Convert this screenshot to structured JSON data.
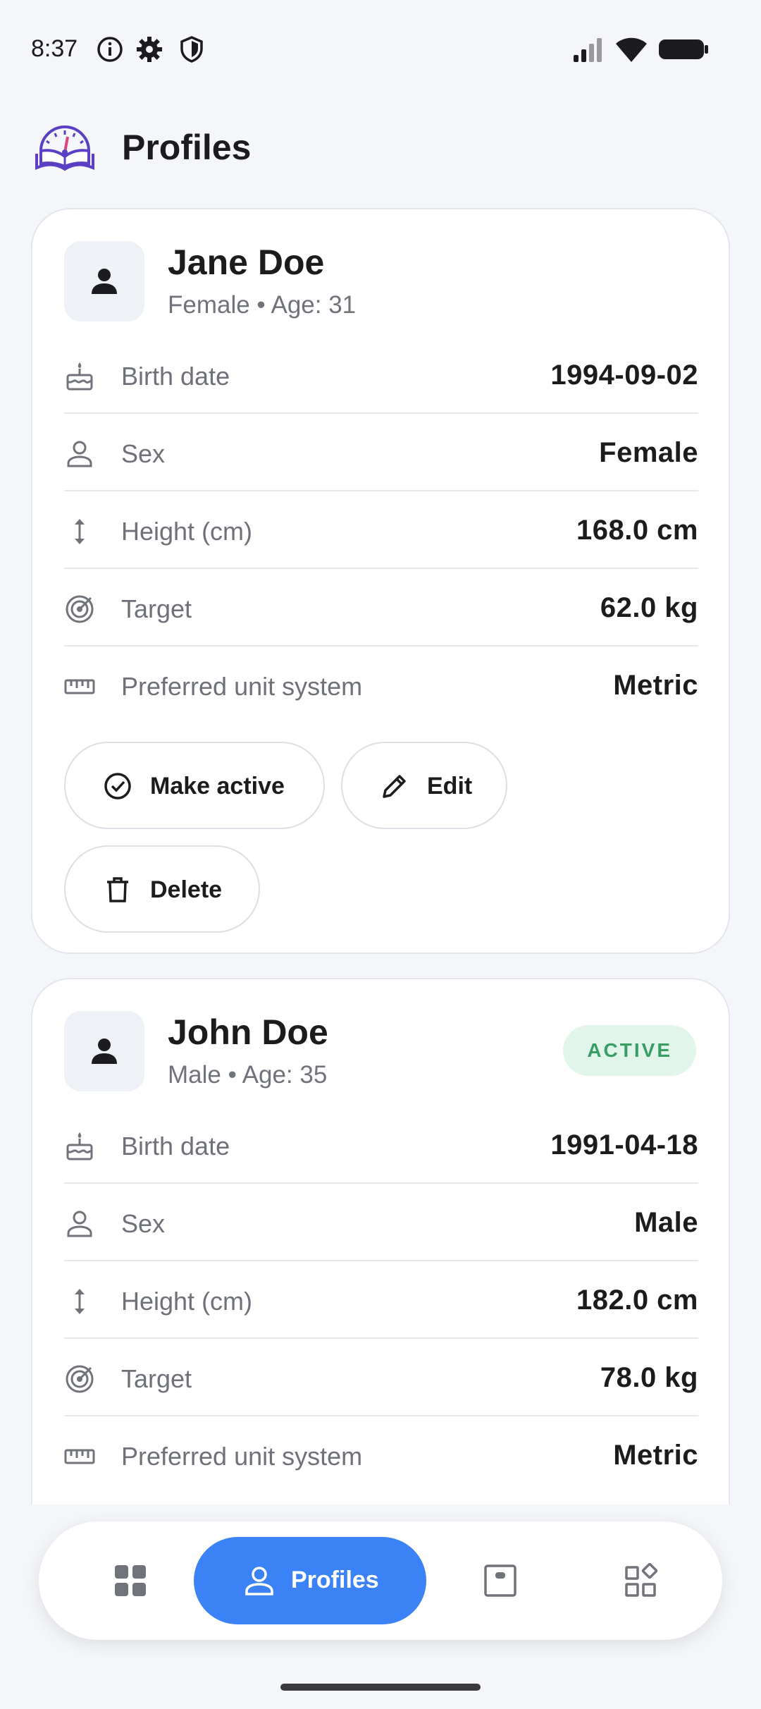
{
  "status_bar": {
    "time": "8:37",
    "left_icons": [
      "info-icon",
      "gear-icon",
      "shield-icon"
    ],
    "right_icons": [
      "signal-icon",
      "wifi-icon",
      "battery-icon"
    ]
  },
  "header": {
    "title": "Profiles",
    "logo_icon": "book-gauge-logo"
  },
  "profiles": [
    {
      "name": "Jane Doe",
      "subtitle": "Female • Age: 31",
      "active": false,
      "rows": [
        {
          "icon": "cake-icon",
          "label": "Birth date",
          "value": "1994-09-02"
        },
        {
          "icon": "person-icon",
          "label": "Sex",
          "value": "Female"
        },
        {
          "icon": "height-arrows-icon",
          "label": "Height (cm)",
          "value": "168.0 cm"
        },
        {
          "icon": "target-icon",
          "label": "Target",
          "value": "62.0 kg"
        },
        {
          "icon": "ruler-icon",
          "label": "Preferred unit system",
          "value": "Metric"
        }
      ],
      "actions": {
        "make_active": "Make active",
        "edit": "Edit",
        "delete": "Delete"
      }
    },
    {
      "name": "John Doe",
      "subtitle": "Male • Age: 35",
      "active": true,
      "badge": "ACTIVE",
      "rows": [
        {
          "icon": "cake-icon",
          "label": "Birth date",
          "value": "1991-04-18"
        },
        {
          "icon": "person-icon",
          "label": "Sex",
          "value": "Male"
        },
        {
          "icon": "height-arrows-icon",
          "label": "Height (cm)",
          "value": "182.0 cm"
        },
        {
          "icon": "target-icon",
          "label": "Target",
          "value": "78.0 kg"
        },
        {
          "icon": "ruler-icon",
          "label": "Preferred unit system",
          "value": "Metric"
        }
      ]
    }
  ],
  "bottom_nav": {
    "items": [
      {
        "icon": "dashboard-icon",
        "label": ""
      },
      {
        "icon": "person-icon",
        "label": "Profiles",
        "selected": true
      },
      {
        "icon": "scale-icon",
        "label": ""
      },
      {
        "icon": "more-apps-icon",
        "label": ""
      }
    ]
  },
  "colors": {
    "accent": "#3B82F6",
    "background": "#F4F6FA",
    "card": "#FFFFFF",
    "active_badge_bg": "#E1F5EA",
    "active_badge_text": "#3A9D65"
  }
}
